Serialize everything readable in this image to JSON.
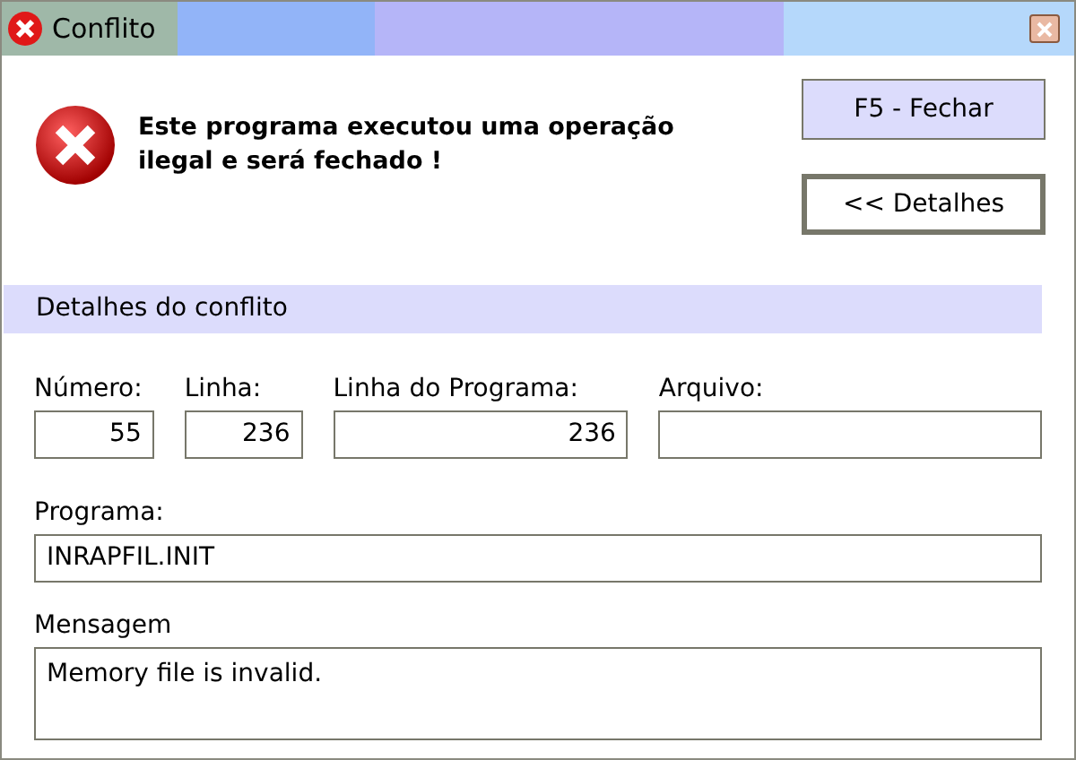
{
  "window": {
    "title": "Conflito"
  },
  "message": "Este programa executou uma operação ilegal e será fechado !",
  "buttons": [
    {
      "label": "F5 - Fechar",
      "kind": "primary"
    },
    {
      "label": "<< Detalhes",
      "kind": "default"
    }
  ],
  "section": {
    "title": "Detalhes do conflito"
  },
  "fields": [
    {
      "label": "Número:",
      "value": "55",
      "kind": "number"
    },
    {
      "label": "Linha:",
      "value": "236",
      "kind": "number"
    },
    {
      "label": "Linha do Programa:",
      "value": "236",
      "kind": "number"
    },
    {
      "label": "Arquivo:",
      "kind": "text"
    }
  ],
  "programa": {
    "label": "Programa:",
    "value": "INRAPFIL.INIT"
  },
  "mensagem": {
    "label": "Mensagem",
    "value": "Memory file is invalid."
  }
}
